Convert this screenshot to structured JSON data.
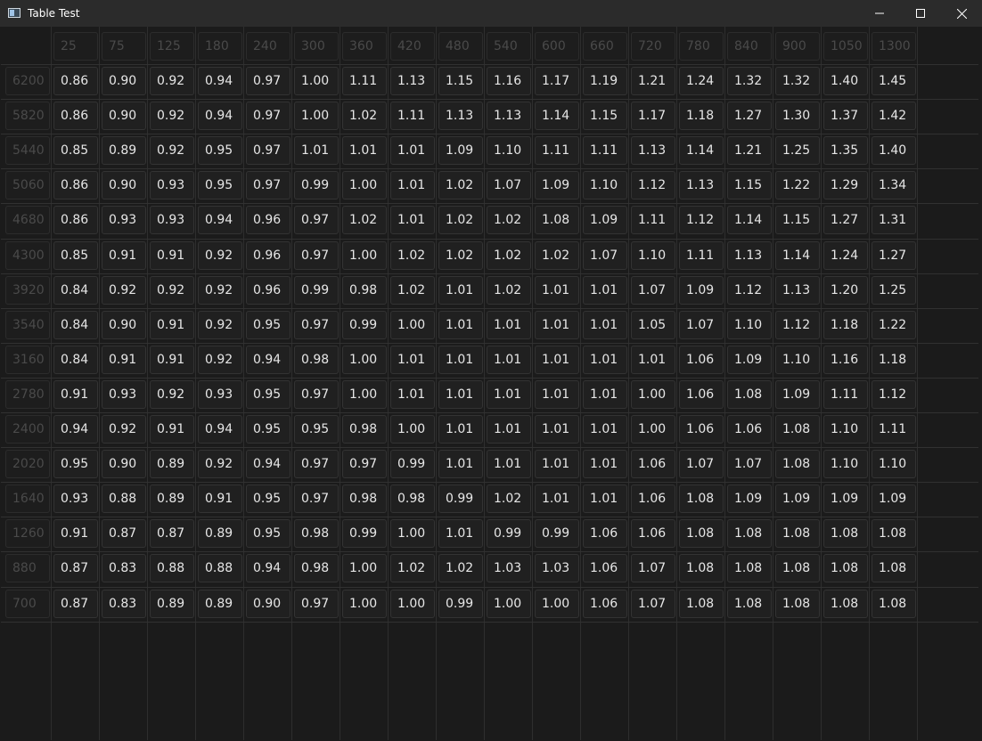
{
  "window": {
    "title": "Table Test"
  },
  "table": {
    "columns": [
      "25",
      "75",
      "125",
      "180",
      "240",
      "300",
      "360",
      "420",
      "480",
      "540",
      "600",
      "660",
      "720",
      "780",
      "840",
      "900",
      "1050",
      "1300"
    ],
    "rows": [
      "6200",
      "5820",
      "5440",
      "5060",
      "4680",
      "4300",
      "3920",
      "3540",
      "3160",
      "2780",
      "2400",
      "2020",
      "1640",
      "1260",
      "880",
      "700"
    ],
    "values": [
      [
        "0.86",
        "0.90",
        "0.92",
        "0.94",
        "0.97",
        "1.00",
        "1.11",
        "1.13",
        "1.15",
        "1.16",
        "1.17",
        "1.19",
        "1.21",
        "1.24",
        "1.32",
        "1.32",
        "1.40",
        "1.45"
      ],
      [
        "0.86",
        "0.90",
        "0.92",
        "0.94",
        "0.97",
        "1.00",
        "1.02",
        "1.11",
        "1.13",
        "1.13",
        "1.14",
        "1.15",
        "1.17",
        "1.18",
        "1.27",
        "1.30",
        "1.37",
        "1.42"
      ],
      [
        "0.85",
        "0.89",
        "0.92",
        "0.95",
        "0.97",
        "1.01",
        "1.01",
        "1.01",
        "1.09",
        "1.10",
        "1.11",
        "1.11",
        "1.13",
        "1.14",
        "1.21",
        "1.25",
        "1.35",
        "1.40"
      ],
      [
        "0.86",
        "0.90",
        "0.93",
        "0.95",
        "0.97",
        "0.99",
        "1.00",
        "1.01",
        "1.02",
        "1.07",
        "1.09",
        "1.10",
        "1.12",
        "1.13",
        "1.15",
        "1.22",
        "1.29",
        "1.34"
      ],
      [
        "0.86",
        "0.93",
        "0.93",
        "0.94",
        "0.96",
        "0.97",
        "1.02",
        "1.01",
        "1.02",
        "1.02",
        "1.08",
        "1.09",
        "1.11",
        "1.12",
        "1.14",
        "1.15",
        "1.27",
        "1.31"
      ],
      [
        "0.85",
        "0.91",
        "0.91",
        "0.92",
        "0.96",
        "0.97",
        "1.00",
        "1.02",
        "1.02",
        "1.02",
        "1.02",
        "1.07",
        "1.10",
        "1.11",
        "1.13",
        "1.14",
        "1.24",
        "1.27"
      ],
      [
        "0.84",
        "0.92",
        "0.92",
        "0.92",
        "0.96",
        "0.99",
        "0.98",
        "1.02",
        "1.01",
        "1.02",
        "1.01",
        "1.01",
        "1.07",
        "1.09",
        "1.12",
        "1.13",
        "1.20",
        "1.25"
      ],
      [
        "0.84",
        "0.90",
        "0.91",
        "0.92",
        "0.95",
        "0.97",
        "0.99",
        "1.00",
        "1.01",
        "1.01",
        "1.01",
        "1.01",
        "1.05",
        "1.07",
        "1.10",
        "1.12",
        "1.18",
        "1.22"
      ],
      [
        "0.84",
        "0.91",
        "0.91",
        "0.92",
        "0.94",
        "0.98",
        "1.00",
        "1.01",
        "1.01",
        "1.01",
        "1.01",
        "1.01",
        "1.01",
        "1.06",
        "1.09",
        "1.10",
        "1.16",
        "1.18"
      ],
      [
        "0.91",
        "0.93",
        "0.92",
        "0.93",
        "0.95",
        "0.97",
        "1.00",
        "1.01",
        "1.01",
        "1.01",
        "1.01",
        "1.01",
        "1.00",
        "1.06",
        "1.08",
        "1.09",
        "1.11",
        "1.12"
      ],
      [
        "0.94",
        "0.92",
        "0.91",
        "0.94",
        "0.95",
        "0.95",
        "0.98",
        "1.00",
        "1.01",
        "1.01",
        "1.01",
        "1.01",
        "1.00",
        "1.06",
        "1.06",
        "1.08",
        "1.10",
        "1.11"
      ],
      [
        "0.95",
        "0.90",
        "0.89",
        "0.92",
        "0.94",
        "0.97",
        "0.97",
        "0.99",
        "1.01",
        "1.01",
        "1.01",
        "1.01",
        "1.06",
        "1.07",
        "1.07",
        "1.08",
        "1.10",
        "1.10"
      ],
      [
        "0.93",
        "0.88",
        "0.89",
        "0.91",
        "0.95",
        "0.97",
        "0.98",
        "0.98",
        "0.99",
        "1.02",
        "1.01",
        "1.01",
        "1.06",
        "1.08",
        "1.09",
        "1.09",
        "1.09",
        "1.09"
      ],
      [
        "0.91",
        "0.87",
        "0.87",
        "0.89",
        "0.95",
        "0.98",
        "0.99",
        "1.00",
        "1.01",
        "0.99",
        "0.99",
        "1.06",
        "1.06",
        "1.08",
        "1.08",
        "1.08",
        "1.08",
        "1.08"
      ],
      [
        "0.87",
        "0.83",
        "0.88",
        "0.88",
        "0.94",
        "0.98",
        "1.00",
        "1.02",
        "1.02",
        "1.03",
        "1.03",
        "1.06",
        "1.07",
        "1.08",
        "1.08",
        "1.08",
        "1.08",
        "1.08"
      ],
      [
        "0.87",
        "0.83",
        "0.89",
        "0.89",
        "0.90",
        "0.97",
        "1.00",
        "1.00",
        "0.99",
        "1.00",
        "1.00",
        "1.06",
        "1.07",
        "1.08",
        "1.08",
        "1.08",
        "1.08",
        "1.08"
      ]
    ]
  },
  "icons": {
    "app": "app-window-icon",
    "minimize": "minimize-icon",
    "maximize": "maximize-icon",
    "close": "close-icon"
  },
  "colors": {
    "background": "#1b1b1b",
    "titlebar": "#2b2b2b",
    "cell_text": "#e6e6e6",
    "header_text": "#4a4a4a"
  }
}
